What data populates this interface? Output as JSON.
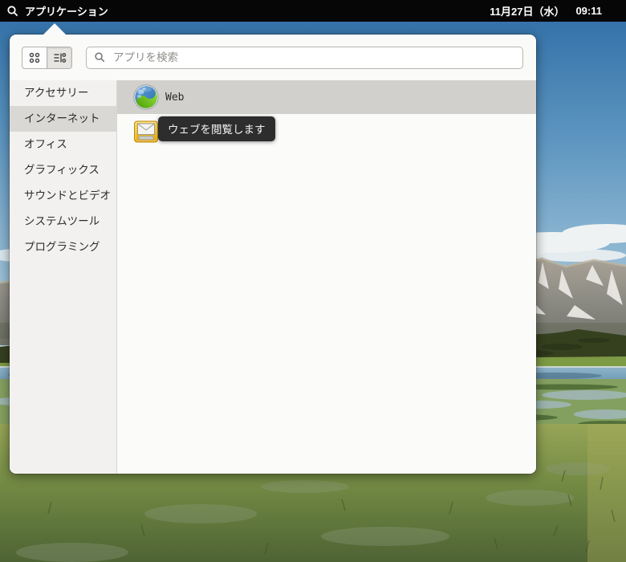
{
  "topbar": {
    "menu_label": "アプリケーション",
    "date": "11月27日（水）",
    "time": "09:11"
  },
  "popup": {
    "search_placeholder": "アプリを検索",
    "view_toggles": [
      {
        "name": "grid-view",
        "active": false
      },
      {
        "name": "list-view",
        "active": true
      }
    ],
    "categories": [
      {
        "label": "アクセサリー",
        "selected": false
      },
      {
        "label": "インターネット",
        "selected": true
      },
      {
        "label": "オフィス",
        "selected": false
      },
      {
        "label": "グラフィックス",
        "selected": false
      },
      {
        "label": "サウンドとビデオ",
        "selected": false
      },
      {
        "label": "システムツール",
        "selected": false
      },
      {
        "label": "プログラミング",
        "selected": false
      }
    ],
    "apps": [
      {
        "label": "Web",
        "icon": "globe-icon",
        "highlighted": true
      },
      {
        "label": "",
        "icon": "envelope-icon",
        "highlighted": false
      }
    ],
    "tooltip": "ウェブを閲覧します"
  },
  "colors": {
    "topbar_bg": "#060606",
    "popup_bg": "#fafaf9",
    "sidebar_bg": "#f2f1ef",
    "sidebar_selected": "#dad8d5",
    "row_highlight": "#d2d0cd",
    "tooltip_bg": "#2d2d2d",
    "sky_top": "#2e6ca5",
    "sky_bottom": "#c6dae6"
  }
}
